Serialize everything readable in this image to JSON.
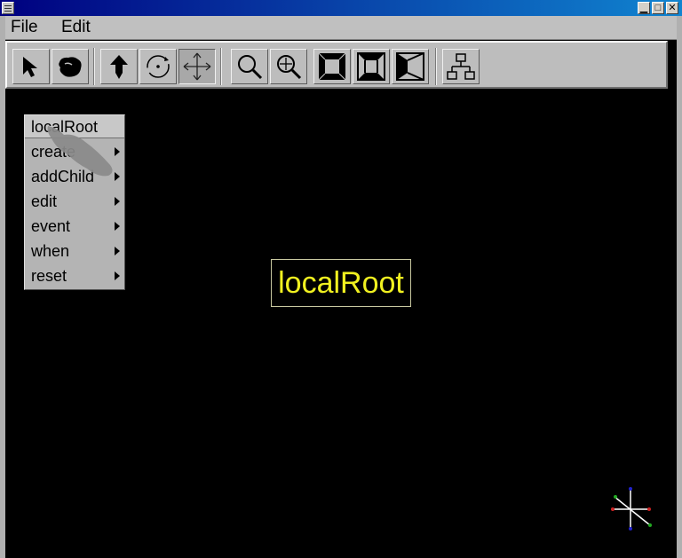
{
  "window": {
    "minimize_glyph": "▁",
    "maximize_glyph": "□",
    "close_glyph": "✕"
  },
  "menubar": {
    "file_label": "File",
    "edit_label": "Edit"
  },
  "toolbar": {
    "buttons": [
      {
        "icon": "select-arrow-icon"
      },
      {
        "icon": "hand-icon"
      },
      {
        "icon": "translate-up-icon"
      },
      {
        "icon": "rotate-icon"
      },
      {
        "icon": "move-cross-icon",
        "pressed": true
      },
      {
        "icon": "zoom-icon"
      },
      {
        "icon": "zoom-fit-icon"
      },
      {
        "icon": "view-front-icon"
      },
      {
        "icon": "view-perspective-icon"
      },
      {
        "icon": "view-side-icon"
      },
      {
        "icon": "scene-graph-icon"
      }
    ]
  },
  "context_menu": {
    "title": "localRoot",
    "items": [
      {
        "label": "create"
      },
      {
        "label": "addChild"
      },
      {
        "label": "edit"
      },
      {
        "label": "event"
      },
      {
        "label": "when"
      },
      {
        "label": "reset"
      }
    ]
  },
  "canvas": {
    "node_label": "localRoot",
    "node_color": "#f0f020",
    "axis_colors": {
      "x": "#cc2222",
      "y": "#2222cc",
      "z": "#22aa22"
    }
  }
}
